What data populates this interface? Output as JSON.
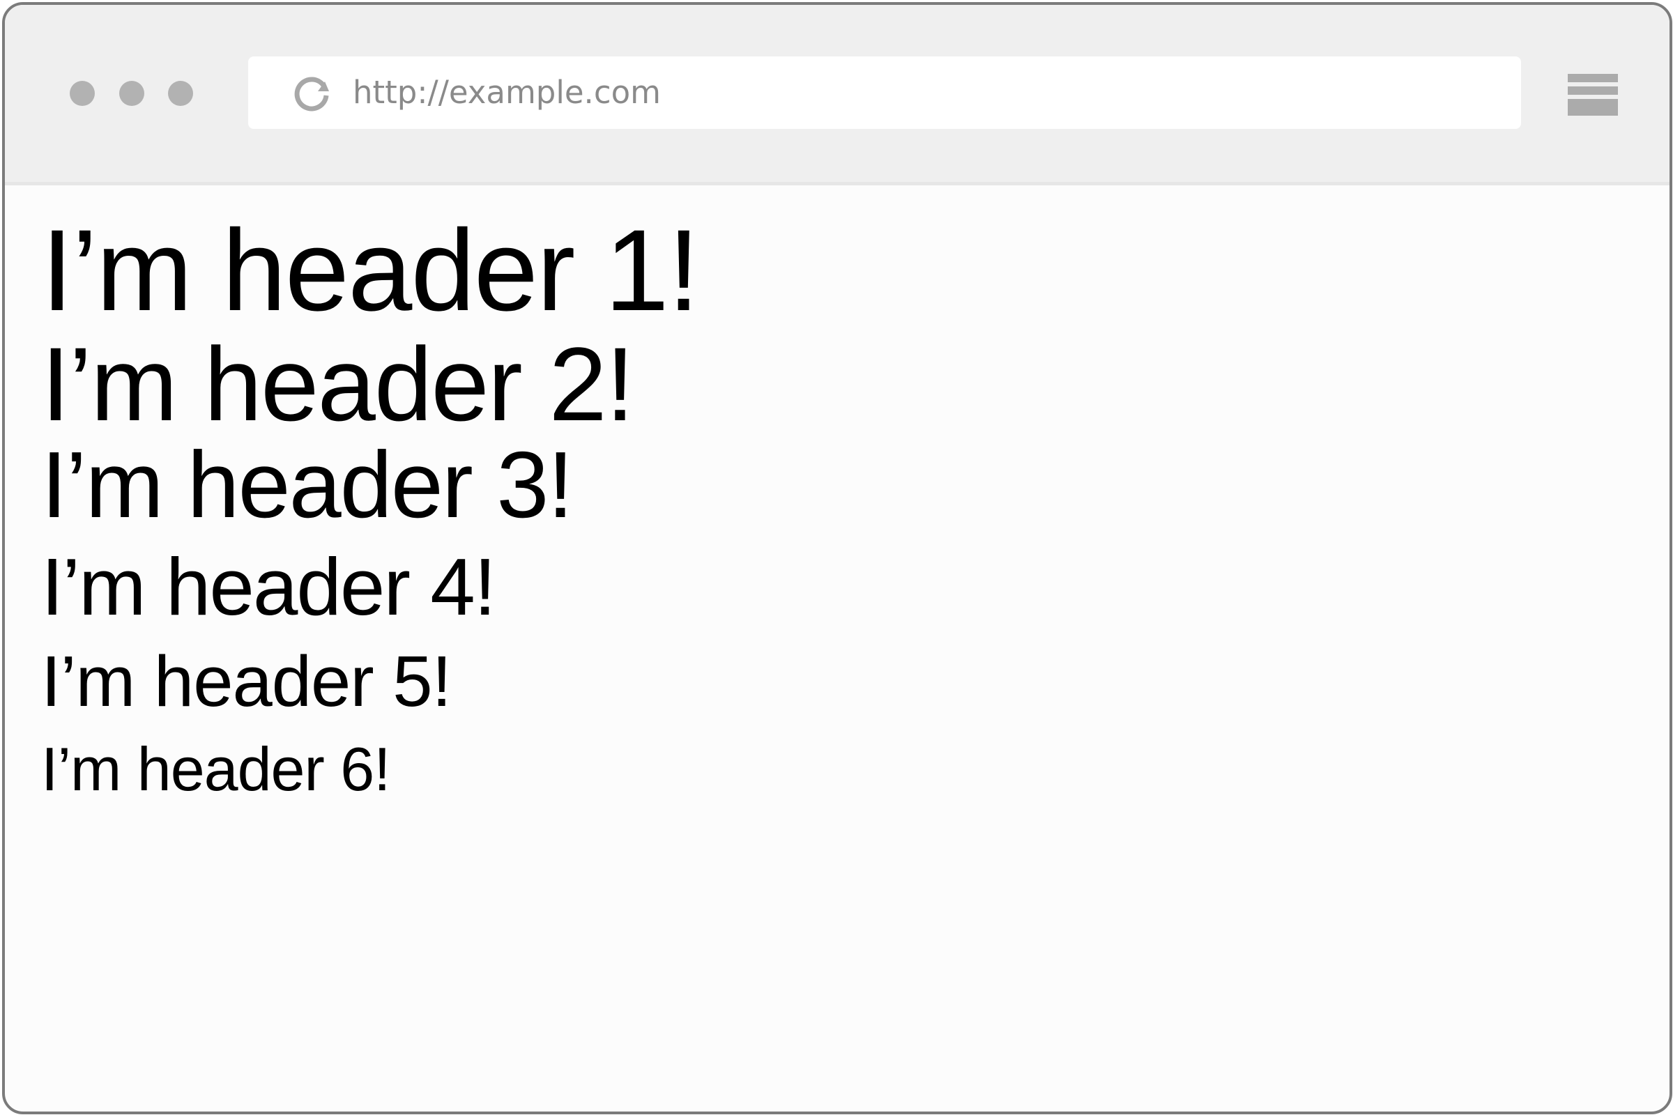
{
  "browser": {
    "url": "http://example.com",
    "icons": {
      "reload": "reload-icon",
      "menu": "hamburger-menu-icon"
    },
    "window_dot_color": "#b2b2b2"
  },
  "page": {
    "headers": [
      "I’m header 1!",
      "I’m header 2!",
      "I’m header 3!",
      "I’m header 4!",
      "I’m header 5!",
      "I’m header 6!"
    ]
  }
}
